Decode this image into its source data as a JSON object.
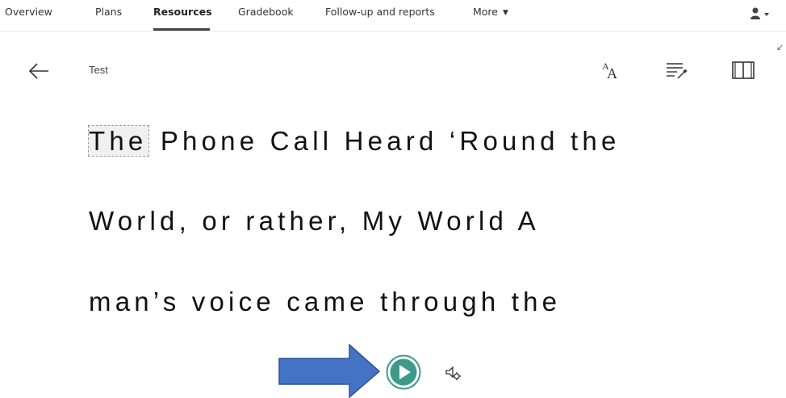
{
  "nav": {
    "items": [
      {
        "label": "Overview"
      },
      {
        "label": "Plans"
      },
      {
        "label": "Resources"
      },
      {
        "label": "Gradebook"
      },
      {
        "label": "Follow-up and reports"
      },
      {
        "label": "More"
      }
    ],
    "active": "Resources",
    "icons": {
      "more_caret": "chevron-down-icon",
      "user": "user-icon"
    }
  },
  "reader": {
    "title": "Test",
    "toolbar": {
      "text_preferences_icon": "text-size-icon",
      "grammar_options_icon": "grammar-options-icon",
      "reading_preferences_icon": "book-icon"
    },
    "lines": {
      "line1_highlight": "The",
      "line1_rest": " Phone Call Heard ‘Round the",
      "line2": "World, or rather, My World A",
      "line3": "man’s voice came through the"
    },
    "controls": {
      "play_icon": "play-icon",
      "voice_settings_icon": "voice-settings-icon",
      "annotation": "arrow-right-icon"
    }
  },
  "colors": {
    "play_button": "#3d9a8b",
    "annotation_arrow": "#4472c4",
    "annotation_border": "#2f528f"
  }
}
